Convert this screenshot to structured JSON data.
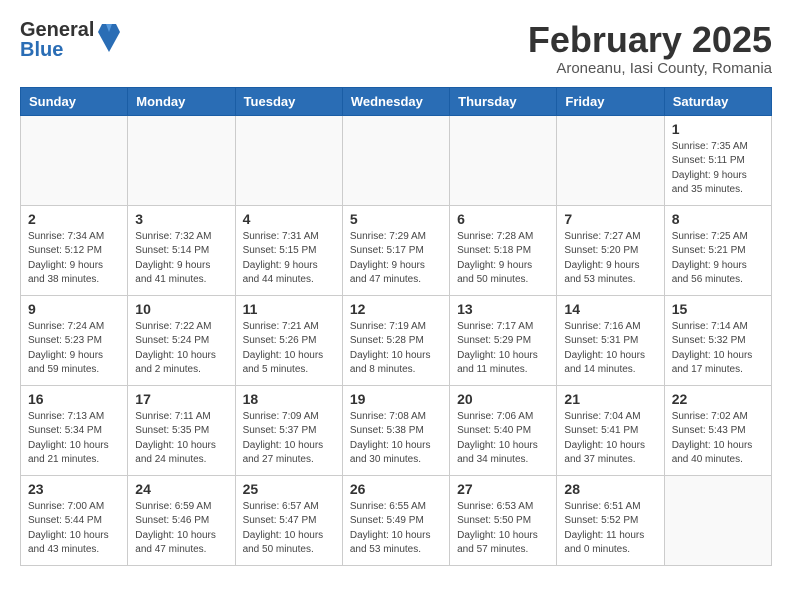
{
  "header": {
    "logo_general": "General",
    "logo_blue": "Blue",
    "month_title": "February 2025",
    "subtitle": "Aroneanu, Iasi County, Romania"
  },
  "days_of_week": [
    "Sunday",
    "Monday",
    "Tuesday",
    "Wednesday",
    "Thursday",
    "Friday",
    "Saturday"
  ],
  "weeks": [
    [
      {
        "day": "",
        "info": ""
      },
      {
        "day": "",
        "info": ""
      },
      {
        "day": "",
        "info": ""
      },
      {
        "day": "",
        "info": ""
      },
      {
        "day": "",
        "info": ""
      },
      {
        "day": "",
        "info": ""
      },
      {
        "day": "1",
        "info": "Sunrise: 7:35 AM\nSunset: 5:11 PM\nDaylight: 9 hours\nand 35 minutes."
      }
    ],
    [
      {
        "day": "2",
        "info": "Sunrise: 7:34 AM\nSunset: 5:12 PM\nDaylight: 9 hours\nand 38 minutes."
      },
      {
        "day": "3",
        "info": "Sunrise: 7:32 AM\nSunset: 5:14 PM\nDaylight: 9 hours\nand 41 minutes."
      },
      {
        "day": "4",
        "info": "Sunrise: 7:31 AM\nSunset: 5:15 PM\nDaylight: 9 hours\nand 44 minutes."
      },
      {
        "day": "5",
        "info": "Sunrise: 7:29 AM\nSunset: 5:17 PM\nDaylight: 9 hours\nand 47 minutes."
      },
      {
        "day": "6",
        "info": "Sunrise: 7:28 AM\nSunset: 5:18 PM\nDaylight: 9 hours\nand 50 minutes."
      },
      {
        "day": "7",
        "info": "Sunrise: 7:27 AM\nSunset: 5:20 PM\nDaylight: 9 hours\nand 53 minutes."
      },
      {
        "day": "8",
        "info": "Sunrise: 7:25 AM\nSunset: 5:21 PM\nDaylight: 9 hours\nand 56 minutes."
      }
    ],
    [
      {
        "day": "9",
        "info": "Sunrise: 7:24 AM\nSunset: 5:23 PM\nDaylight: 9 hours\nand 59 minutes."
      },
      {
        "day": "10",
        "info": "Sunrise: 7:22 AM\nSunset: 5:24 PM\nDaylight: 10 hours\nand 2 minutes."
      },
      {
        "day": "11",
        "info": "Sunrise: 7:21 AM\nSunset: 5:26 PM\nDaylight: 10 hours\nand 5 minutes."
      },
      {
        "day": "12",
        "info": "Sunrise: 7:19 AM\nSunset: 5:28 PM\nDaylight: 10 hours\nand 8 minutes."
      },
      {
        "day": "13",
        "info": "Sunrise: 7:17 AM\nSunset: 5:29 PM\nDaylight: 10 hours\nand 11 minutes."
      },
      {
        "day": "14",
        "info": "Sunrise: 7:16 AM\nSunset: 5:31 PM\nDaylight: 10 hours\nand 14 minutes."
      },
      {
        "day": "15",
        "info": "Sunrise: 7:14 AM\nSunset: 5:32 PM\nDaylight: 10 hours\nand 17 minutes."
      }
    ],
    [
      {
        "day": "16",
        "info": "Sunrise: 7:13 AM\nSunset: 5:34 PM\nDaylight: 10 hours\nand 21 minutes."
      },
      {
        "day": "17",
        "info": "Sunrise: 7:11 AM\nSunset: 5:35 PM\nDaylight: 10 hours\nand 24 minutes."
      },
      {
        "day": "18",
        "info": "Sunrise: 7:09 AM\nSunset: 5:37 PM\nDaylight: 10 hours\nand 27 minutes."
      },
      {
        "day": "19",
        "info": "Sunrise: 7:08 AM\nSunset: 5:38 PM\nDaylight: 10 hours\nand 30 minutes."
      },
      {
        "day": "20",
        "info": "Sunrise: 7:06 AM\nSunset: 5:40 PM\nDaylight: 10 hours\nand 34 minutes."
      },
      {
        "day": "21",
        "info": "Sunrise: 7:04 AM\nSunset: 5:41 PM\nDaylight: 10 hours\nand 37 minutes."
      },
      {
        "day": "22",
        "info": "Sunrise: 7:02 AM\nSunset: 5:43 PM\nDaylight: 10 hours\nand 40 minutes."
      }
    ],
    [
      {
        "day": "23",
        "info": "Sunrise: 7:00 AM\nSunset: 5:44 PM\nDaylight: 10 hours\nand 43 minutes."
      },
      {
        "day": "24",
        "info": "Sunrise: 6:59 AM\nSunset: 5:46 PM\nDaylight: 10 hours\nand 47 minutes."
      },
      {
        "day": "25",
        "info": "Sunrise: 6:57 AM\nSunset: 5:47 PM\nDaylight: 10 hours\nand 50 minutes."
      },
      {
        "day": "26",
        "info": "Sunrise: 6:55 AM\nSunset: 5:49 PM\nDaylight: 10 hours\nand 53 minutes."
      },
      {
        "day": "27",
        "info": "Sunrise: 6:53 AM\nSunset: 5:50 PM\nDaylight: 10 hours\nand 57 minutes."
      },
      {
        "day": "28",
        "info": "Sunrise: 6:51 AM\nSunset: 5:52 PM\nDaylight: 11 hours\nand 0 minutes."
      },
      {
        "day": "",
        "info": ""
      }
    ]
  ]
}
